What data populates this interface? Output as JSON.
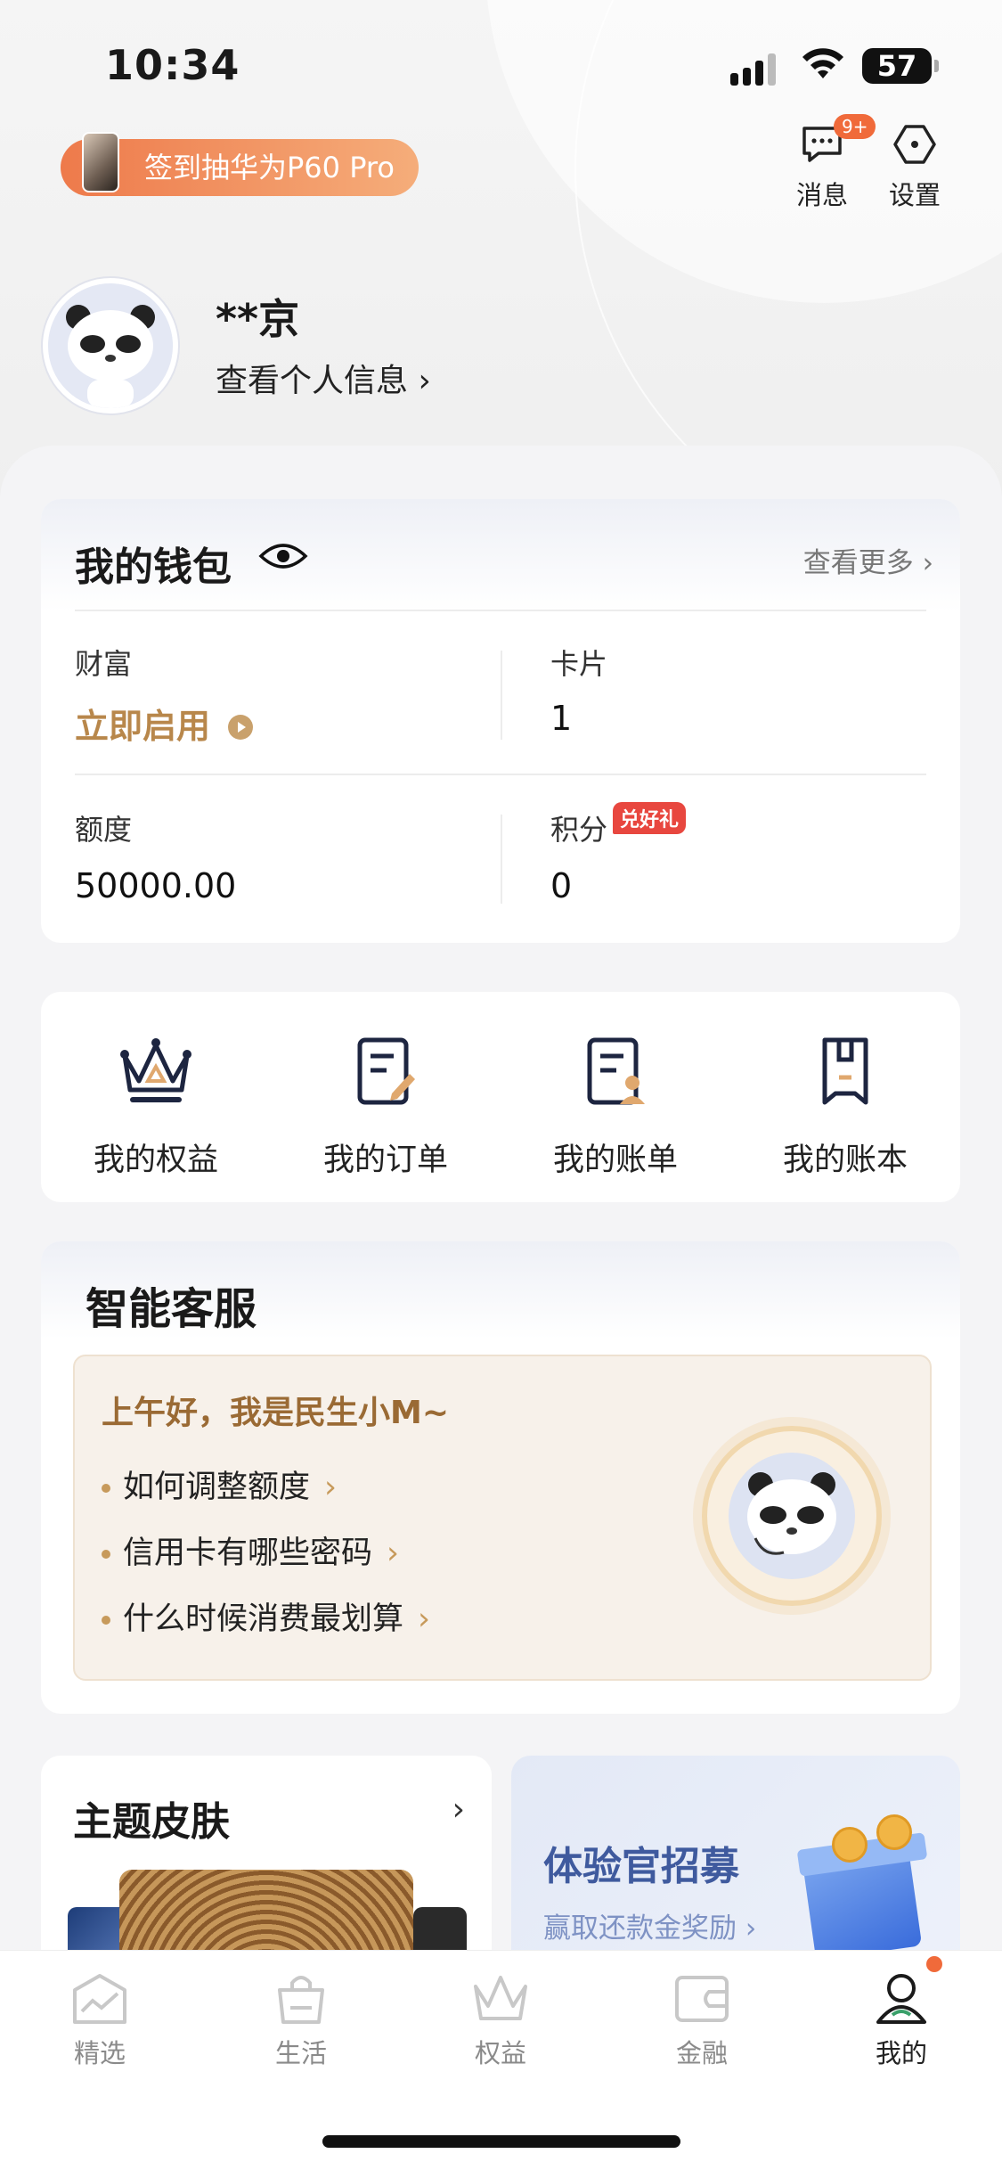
{
  "status_bar": {
    "time": "10:34",
    "battery": "57"
  },
  "promo": {
    "label": "签到抽华为P60 Pro"
  },
  "top_actions": {
    "messages": {
      "label": "消息",
      "badge": "9+"
    },
    "settings": {
      "label": "设置"
    }
  },
  "profile": {
    "name": "**京",
    "link": "查看个人信息 ›"
  },
  "wallet": {
    "title": "我的钱包",
    "more": "查看更多 ›",
    "wealth": {
      "label": "财富",
      "value": "立即启用"
    },
    "cards": {
      "label": "卡片",
      "value": "1"
    },
    "limit": {
      "label": "额度",
      "value": "50000.00"
    },
    "points": {
      "label": "积分",
      "value": "0",
      "badge": "兑好礼"
    }
  },
  "shortcuts": [
    {
      "label": "我的权益",
      "icon": "crown-icon"
    },
    {
      "label": "我的订单",
      "icon": "order-icon"
    },
    {
      "label": "我的账单",
      "icon": "bill-icon"
    },
    {
      "label": "我的账本",
      "icon": "ledger-icon"
    }
  ],
  "service": {
    "title": "智能客服",
    "greeting": "上午好，我是民生小M~",
    "questions": [
      "如何调整额度",
      "信用卡有哪些密码",
      "什么时候消费最划算"
    ]
  },
  "theme": {
    "title": "主题皮肤",
    "arrow": "›"
  },
  "recruit": {
    "title": "体验官招募",
    "subtitle": "赢取还款金奖励 ›"
  },
  "tabs": [
    {
      "label": "精选",
      "icon": "featured-icon",
      "active": false
    },
    {
      "label": "生活",
      "icon": "life-bag-icon",
      "active": false
    },
    {
      "label": "权益",
      "icon": "benefits-crown-icon",
      "active": false
    },
    {
      "label": "金融",
      "icon": "wallet-icon",
      "active": false
    },
    {
      "label": "我的",
      "icon": "profile-icon",
      "active": true
    }
  ],
  "colors": {
    "accent_gold": "#b8874b",
    "badge_orange": "#f06a3a",
    "badge_red": "#e8473f",
    "recruit_blue": "#3f5a9e"
  }
}
